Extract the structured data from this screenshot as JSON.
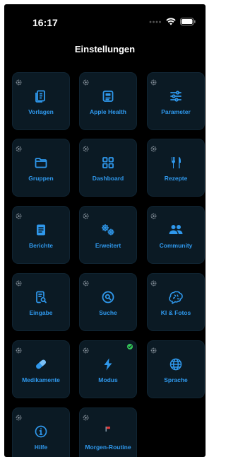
{
  "status_bar": {
    "time": "16:17"
  },
  "header": {
    "title": "Einstellungen"
  },
  "tiles": [
    {
      "label": "Vorlagen",
      "icon": "document-stack-icon"
    },
    {
      "label": "Apple Health",
      "icon": "id-card-icon"
    },
    {
      "label": "Parameter",
      "icon": "sliders-icon"
    },
    {
      "label": "Gruppen",
      "icon": "folder-icon"
    },
    {
      "label": "Dashboard",
      "icon": "grid-icon"
    },
    {
      "label": "Rezepte",
      "icon": "fork-knife-icon"
    },
    {
      "label": "Berichte",
      "icon": "report-icon"
    },
    {
      "label": "Erweitert",
      "icon": "gears-icon"
    },
    {
      "label": "Community",
      "icon": "people-icon"
    },
    {
      "label": "Eingabe",
      "icon": "doc-search-icon"
    },
    {
      "label": "Suche",
      "icon": "search-icon"
    },
    {
      "label": "KI & Fotos",
      "icon": "brain-icon"
    },
    {
      "label": "Medikamente",
      "icon": "pill-icon"
    },
    {
      "label": "Modus",
      "icon": "bolt-icon",
      "active": true
    },
    {
      "label": "Sprache",
      "icon": "globe-icon"
    },
    {
      "label": "Hilfe",
      "icon": "info-icon"
    },
    {
      "label": "Morgen-Routine",
      "icon": "flag-icon"
    }
  ],
  "colors": {
    "accent": "#2f98ec",
    "tile_bg": "#0b1a24",
    "active_check": "#34c759"
  }
}
